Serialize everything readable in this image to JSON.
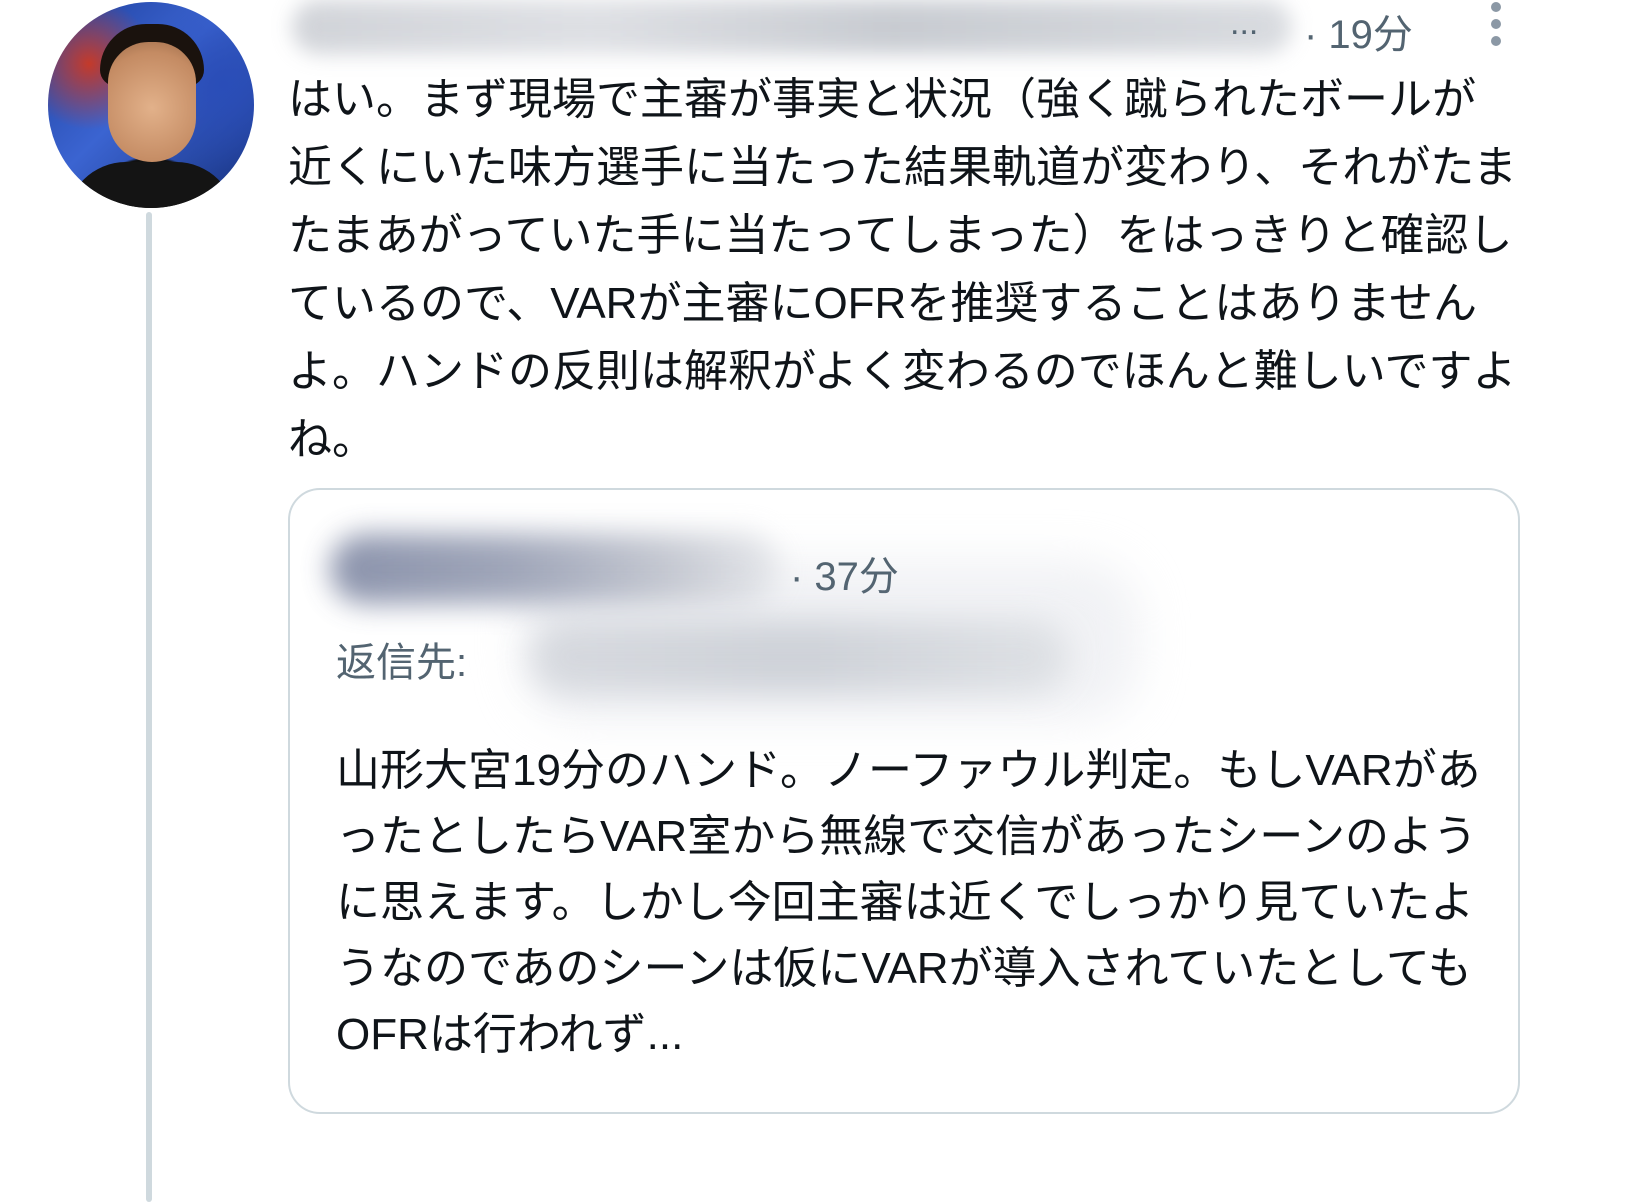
{
  "tweet": {
    "time": "· 19分",
    "header_ellipsis": "...",
    "text": "はい。まず現場で主審が事実と状況（強く蹴られたボールが近くにいた味方選手に当たった結果軌道が変わり、それがたまたまあがっていた手に当たってしまった）をはっきりと確認しているので、VARが主審にOFRを推奨することはありませんよ。ハンドの反則は解釈がよく変わるのでほんと難しいですよね。"
  },
  "quoted_tweet": {
    "time": "· 37分",
    "reply_to_label": "返信先:",
    "text": "山形大宮19分のハンド。ノーファウル判定。もしVARがあったとしたらVAR室から無線で交信があったシーンのように思えます。しかし今回主審は近くでしっかり見ていたようなのであのシーンは仮にVARが導入されていたとしてもOFRは行われず..."
  },
  "icons": {
    "more": "more-vertical-icon"
  },
  "colors": {
    "text": "#0f1419",
    "secondary": "#536471",
    "border": "#cfd9de"
  }
}
